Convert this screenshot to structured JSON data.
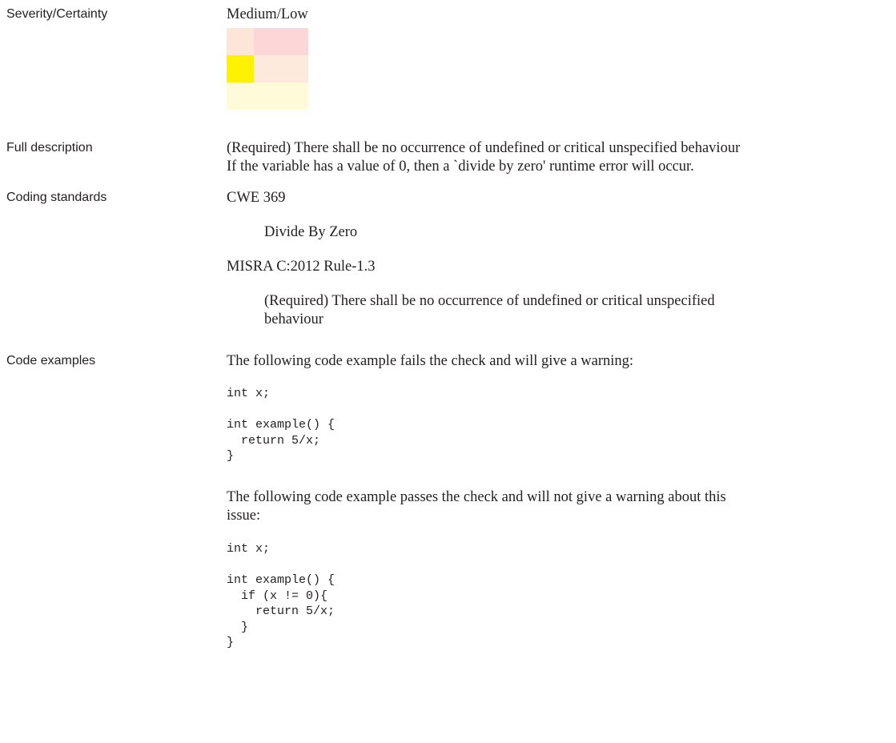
{
  "severity": {
    "label": "Severity/Certainty",
    "value": "Medium/Low",
    "matrix_colors": [
      [
        "#fde6d8",
        "#fdd6d8",
        "#fdd6d8"
      ],
      [
        "#fff200",
        "#feeadd",
        "#feeadd"
      ],
      [
        "#fffbd9",
        "#fffbd9",
        "#fffbd9"
      ]
    ]
  },
  "full_description": {
    "label": "Full description",
    "line1": "(Required) There shall be no occurrence of undefined or critical unspecified behaviour",
    "line2": "If the variable has a value of 0, then a `divide by zero' runtime error will occur."
  },
  "coding_standards": {
    "label": "Coding standards",
    "items": [
      {
        "name": "CWE 369",
        "description_lines": [
          "Divide By Zero"
        ]
      },
      {
        "name": "MISRA C:2012 Rule-1.3",
        "description_lines": [
          "(Required) There shall be no occurrence of undefined or critical unspecified",
          "behaviour"
        ]
      }
    ]
  },
  "code_examples": {
    "label": "Code examples",
    "fail_intro": "The following code example fails the check and will give a warning:",
    "fail_code": "int x;\n\nint example() {\n  return 5/x;\n}",
    "pass_intro_line1": "The following code example passes the check and will not give a warning about this",
    "pass_intro_line2": "issue:",
    "pass_code": "int x;\n\nint example() {\n  if (x != 0){\n    return 5/x;\n  }\n}"
  }
}
